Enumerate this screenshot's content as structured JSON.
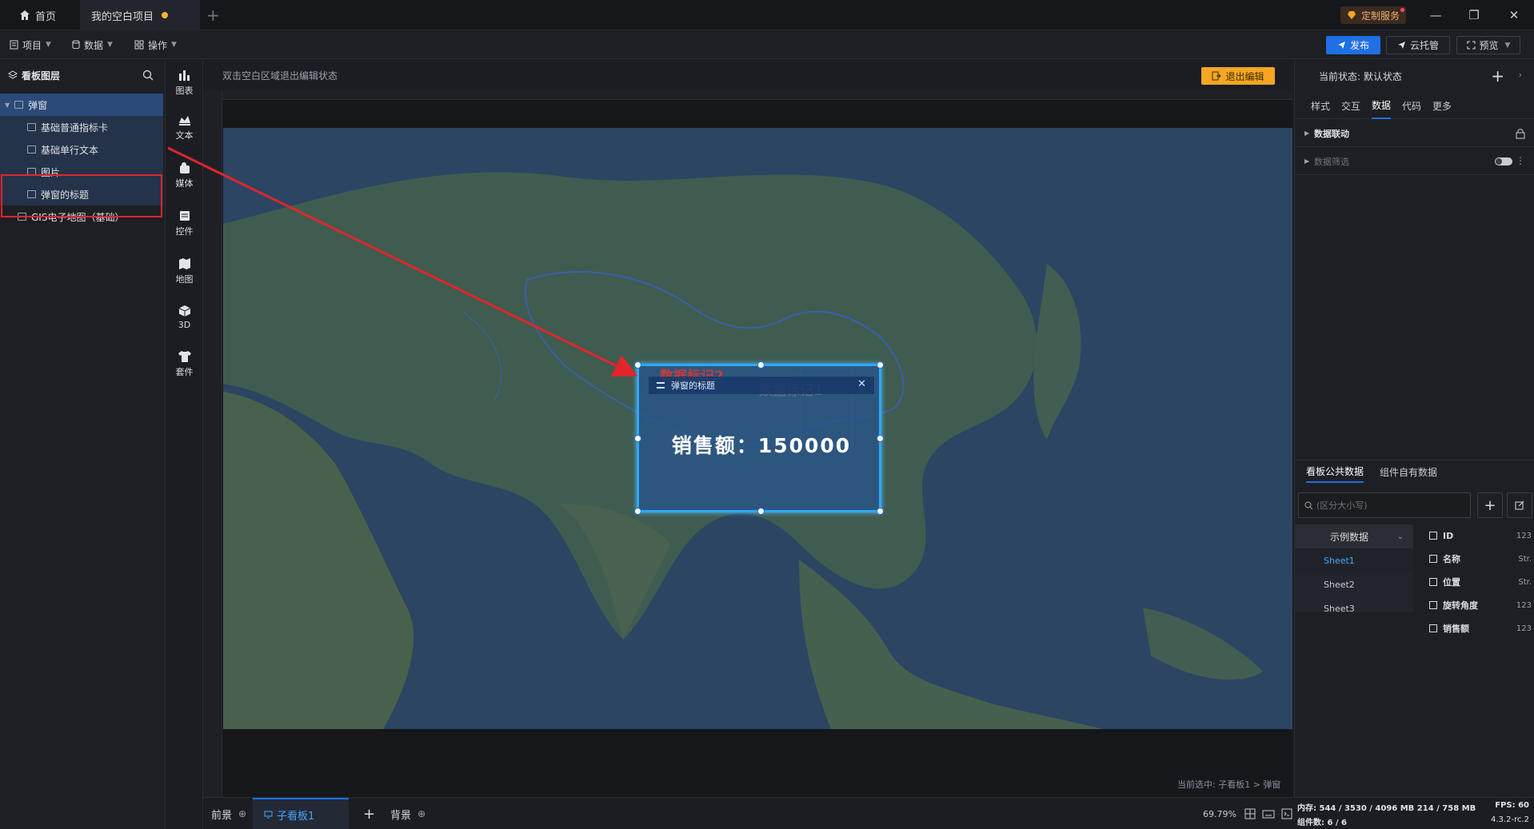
{
  "titlebar": {
    "home_tab": "首页",
    "project_tab": "我的空白项目",
    "custom_service": "定制服务"
  },
  "toolbar": {
    "menu_project": "项目",
    "menu_data": "数据",
    "menu_ops": "操作",
    "publish": "发布",
    "cloud": "云托管",
    "preview": "预览"
  },
  "layers": {
    "title": "看板图层",
    "group": "弹窗",
    "items": [
      "基础普通指标卡",
      "基础单行文本",
      "图片",
      "弹窗的标题"
    ],
    "map_item": "GIS电子地图（基础）"
  },
  "strip": {
    "items": [
      "图表",
      "文本",
      "媒体",
      "控件",
      "地图",
      "3D",
      "套件"
    ]
  },
  "canvas": {
    "hint": "双击空白区域退出编辑状态",
    "exit_edit": "退出编辑",
    "popup_title": "弹窗的标题",
    "popup_tag1": "数据标记2",
    "popup_tag2": "数据标记1",
    "popup_value": "销售额：150000",
    "selected_path": "当前选中: 子看板1 > 弹窗"
  },
  "bottombar": {
    "front": "前景",
    "sub": "子看板1",
    "back": "背景",
    "zoom": "69.79%"
  },
  "rpanel": {
    "state": "当前状态: 默认状态",
    "tabs": [
      "样式",
      "交互",
      "数据",
      "代码",
      "更多"
    ],
    "active_tab": "数据",
    "data_link": "数据联动",
    "data_filter": "数据筛选",
    "data_tabs": [
      "看板公共数据",
      "组件自有数据"
    ],
    "search_placeholder": "(区分大小写)",
    "sheet_group": "示例数据",
    "sheets": [
      "Sheet1",
      "Sheet2",
      "Sheet3"
    ],
    "fields": [
      {
        "name": "ID",
        "type": "123"
      },
      {
        "name": "名称",
        "type": "Str."
      },
      {
        "name": "位置",
        "type": "Str."
      },
      {
        "name": "旋转角度",
        "type": "123"
      },
      {
        "name": "销售额",
        "type": "123"
      }
    ]
  },
  "status": {
    "memory": "内存: 544 / 3530 / 4096 MB  214 / 758 MB",
    "fps": "FPS: 60",
    "count": "组件数: 6 / 6",
    "version": "4.3.2-rc.2"
  },
  "colors": {
    "accent": "#1f6fe5",
    "highlight": "#e0262c",
    "exit": "#f5a623"
  }
}
